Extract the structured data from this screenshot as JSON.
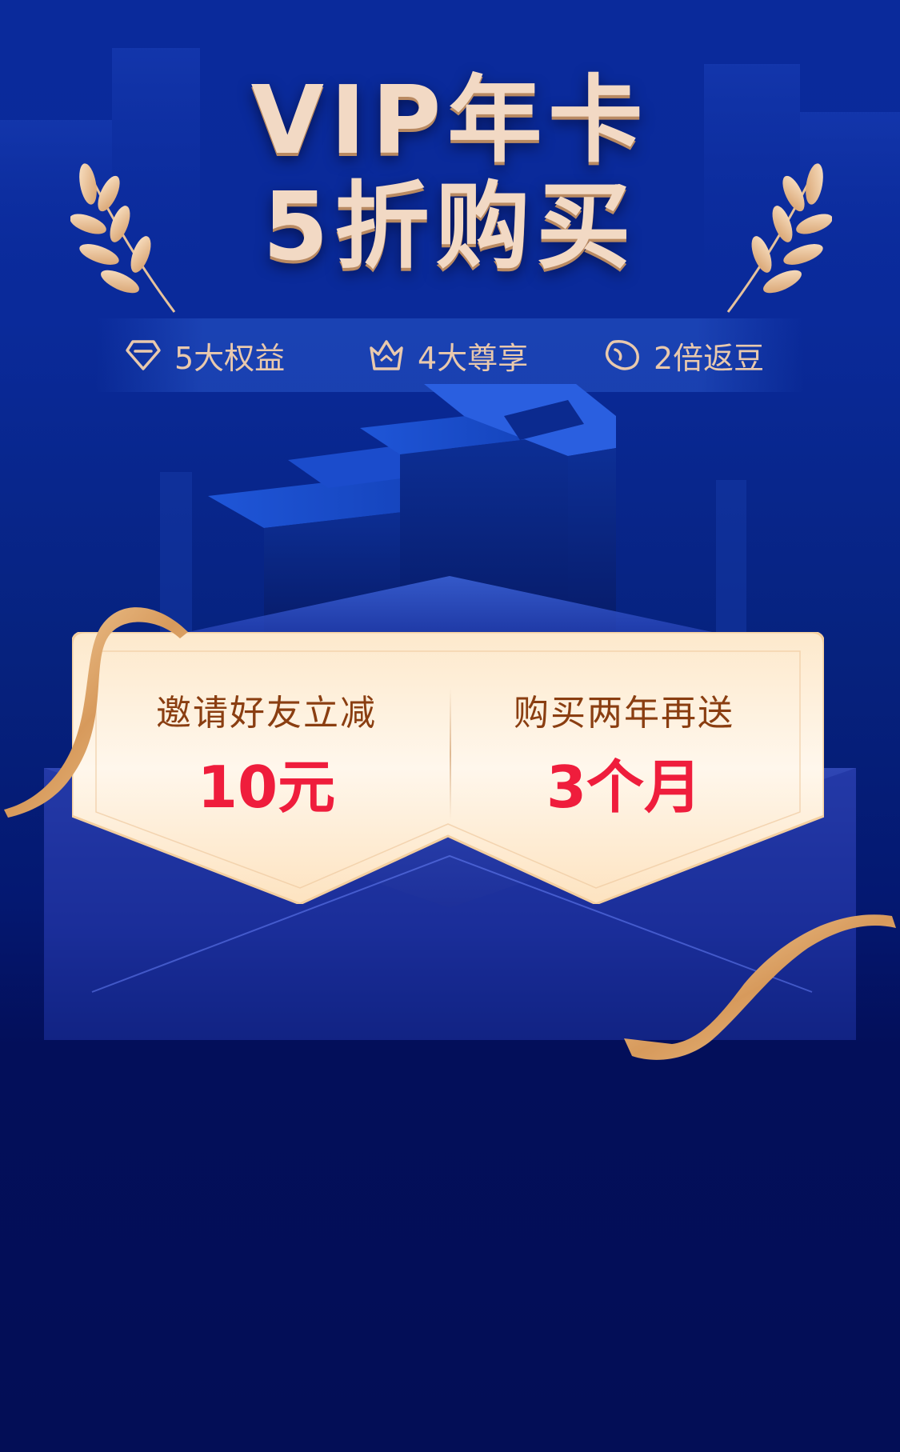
{
  "title": {
    "line1": "VIP年卡",
    "line2": "5折购买"
  },
  "benefits": [
    {
      "icon": "diamond-icon",
      "label": "5大权益"
    },
    {
      "icon": "crown-icon",
      "label": "4大尊享"
    },
    {
      "icon": "bean-icon",
      "label": "2倍返豆"
    }
  ],
  "offers": [
    {
      "label": "邀请好友立减",
      "value": "10元"
    },
    {
      "label": "购买两年再送",
      "value": "3个月"
    }
  ],
  "colors": {
    "background": "#0a2a9b",
    "title_gold": "#f2d9c4",
    "benefit_text": "#e9c9ad",
    "card_label": "#8a3e11",
    "card_value": "#ef1d3c"
  }
}
